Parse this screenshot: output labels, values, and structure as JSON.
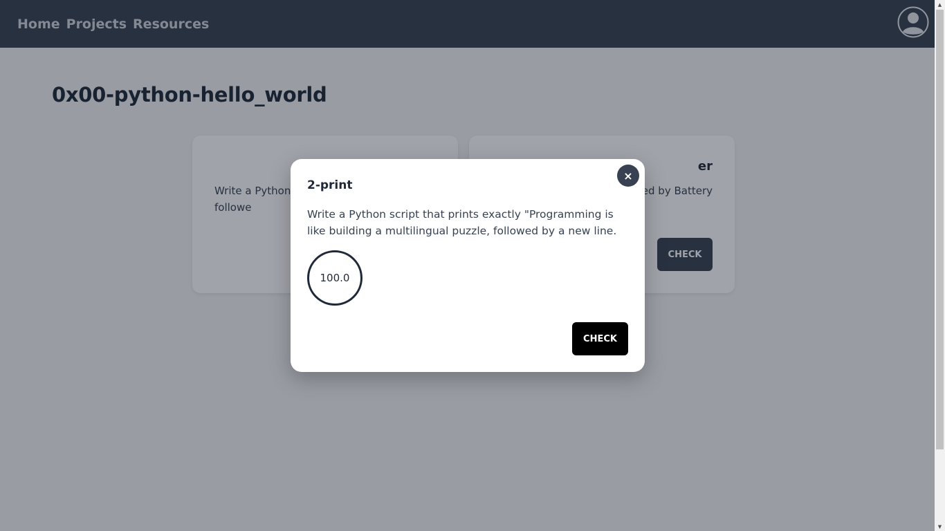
{
  "nav": {
    "links": [
      "Home",
      "Projects",
      "Resources"
    ],
    "avatar_icon": "user-circle-icon"
  },
  "page": {
    "title": "0x00-python-hello_world"
  },
  "cards": [
    {
      "title": "",
      "text": "Write a Python \"Programming puzzle, followe",
      "check_label": ""
    },
    {
      "title": "er",
      "text": "the output ed by Battery",
      "check_label": "CHECK"
    }
  ],
  "modal": {
    "title": "2-print",
    "description": "Write a Python script that prints exactly \"Programming is like building a multilingual puzzle, followed by a new line.",
    "score": "100.0",
    "check_label": "CHECK",
    "close_icon": "close-icon",
    "close_glyph": "×"
  },
  "colors": {
    "navbar": "#374151",
    "overlay": "rgba(17,24,39,0.4)",
    "modal_check": "#000000",
    "card_check": "#374151"
  }
}
